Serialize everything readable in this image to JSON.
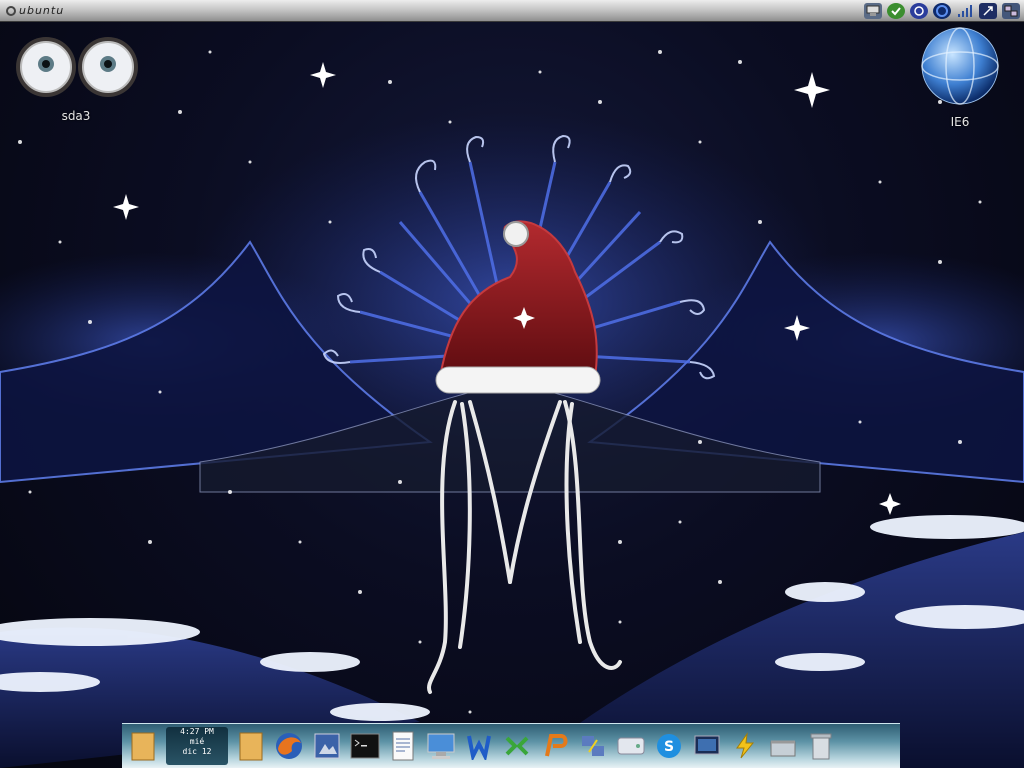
{
  "top_panel": {
    "menu_label": "ubuntu",
    "tray_icons": [
      "network-icon",
      "battery-icon",
      "update-icon",
      "volume-icon",
      "signal-icon",
      "switch-user-icon",
      "network-manager-icon"
    ]
  },
  "desktop": {
    "icons": [
      {
        "label": "sda3",
        "icon": "eyes-drive-icon"
      },
      {
        "label": "IE6",
        "icon": "globe-icon"
      }
    ]
  },
  "dock": {
    "clock": {
      "time": "4:27 PM",
      "day": "mié",
      "date": "dic 12"
    },
    "items": [
      "folder-icon",
      "folder-icon",
      "firefox-icon",
      "photo-icon",
      "terminal-icon",
      "text-editor-icon",
      "computer-icon",
      "wine-icon",
      "network-icon",
      "media-player-icon",
      "transfer-icon",
      "drive-icon",
      "skype-icon",
      "monitor-icon",
      "power-icon",
      "basket-icon",
      "trash-icon"
    ]
  },
  "colors": {
    "sky": "#0b0d22",
    "glow": "#3d5bd6",
    "hat_red": "#8e1a1f",
    "snow": "#eef4ff",
    "dock": "#5d93a6"
  }
}
